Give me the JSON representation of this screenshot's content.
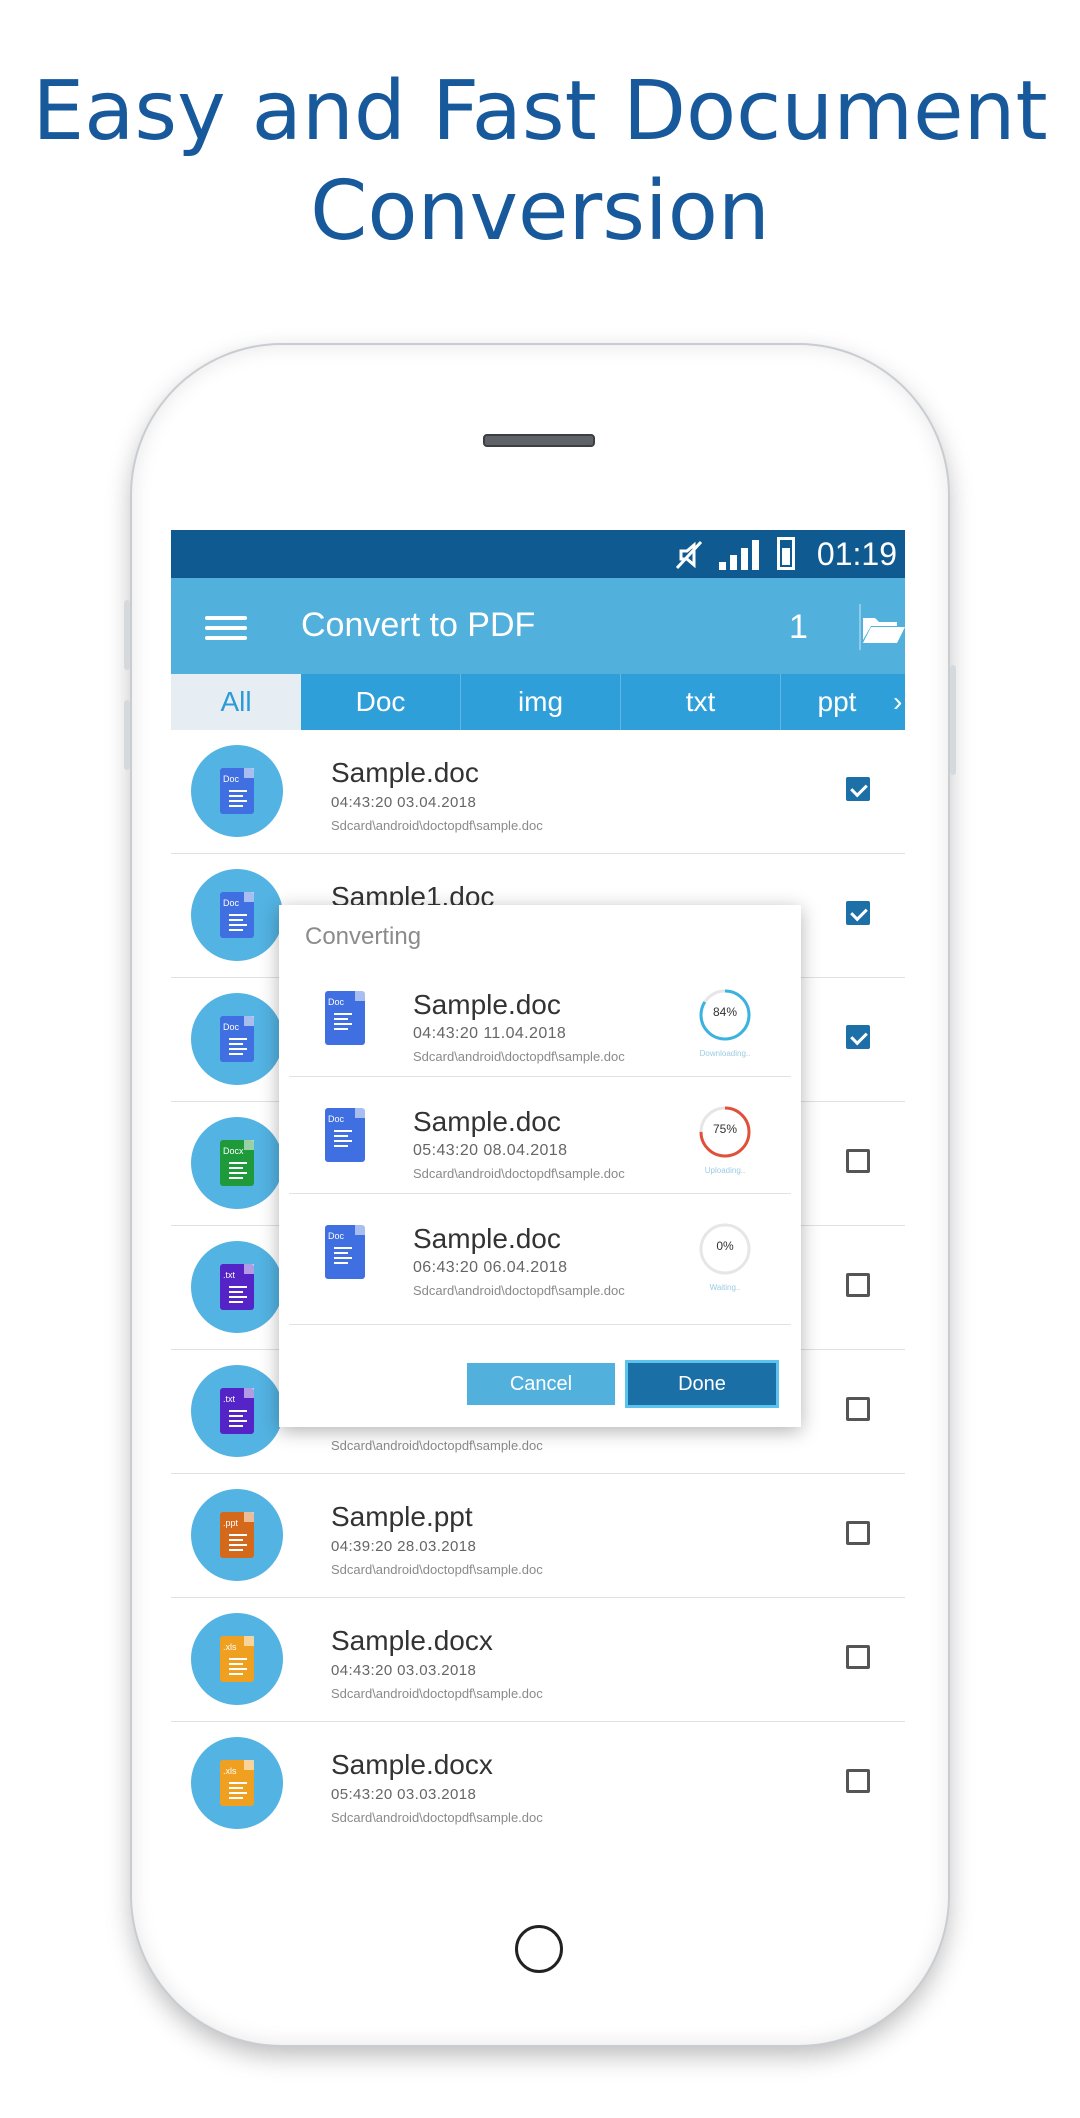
{
  "headline": {
    "line1": "Easy and Fast Document",
    "line2": "Conversion"
  },
  "status_bar": {
    "time": "01:19",
    "icons": [
      "mute-icon",
      "signal-icon",
      "battery-icon"
    ]
  },
  "app_bar": {
    "title": "Convert to PDF",
    "count": "1",
    "menu_icon": "hamburger-menu-icon",
    "folder_icon": "folder-open-icon"
  },
  "tabs": [
    {
      "label": "All",
      "active": true
    },
    {
      "label": "Doc"
    },
    {
      "label": "img"
    },
    {
      "label": "txt"
    },
    {
      "label": "ppt"
    }
  ],
  "tabs_more": "›",
  "files": [
    {
      "name": "Sample.doc",
      "meta": "04:43:20   03.04.2018",
      "path": "Sdcard\\android\\doctopdf\\sample.doc",
      "type": "Doc",
      "color": "#3f6fe0",
      "checked": true
    },
    {
      "name": "Sample1.doc",
      "meta": "",
      "path": "",
      "type": "Doc",
      "color": "#3f6fe0",
      "checked": true
    },
    {
      "name": "",
      "meta": "",
      "path": "",
      "type": "Doc",
      "color": "#3f6fe0",
      "checked": true
    },
    {
      "name": "",
      "meta": "",
      "path": "",
      "type": "Docx",
      "color": "#1e9a3a",
      "checked": false
    },
    {
      "name": "",
      "meta": "",
      "path": "",
      "type": ".txt",
      "color": "#5424c7",
      "checked": false
    },
    {
      "name": "",
      "meta": "",
      "path": "Sdcard\\android\\doctopdf\\sample.doc",
      "type": ".txt",
      "color": "#5424c7",
      "checked": false
    },
    {
      "name": "Sample.ppt",
      "meta": "04:39:20   28.03.2018",
      "path": "Sdcard\\android\\doctopdf\\sample.doc",
      "type": ".ppt",
      "color": "#d4691c",
      "checked": false
    },
    {
      "name": "Sample.docx",
      "meta": "04:43:20   03.03.2018",
      "path": "Sdcard\\android\\doctopdf\\sample.doc",
      "type": ".xls",
      "color": "#f0a020",
      "checked": false
    },
    {
      "name": "Sample.docx",
      "meta": "05:43:20   03.03.2018",
      "path": "Sdcard\\android\\doctopdf\\sample.doc",
      "type": ".xls",
      "color": "#f0a020",
      "checked": false
    }
  ],
  "dialog": {
    "title": "Converting",
    "items": [
      {
        "name": "Sample.doc",
        "meta": "04:43:20   11.04.2018",
        "path": "Sdcard\\android\\doctopdf\\sample.doc",
        "progress": 84,
        "progress_label": "84%",
        "status": "Downloading..",
        "ring_color": "#3bb3e0"
      },
      {
        "name": "Sample.doc",
        "meta": "05:43:20   08.04.2018",
        "path": "Sdcard\\android\\doctopdf\\sample.doc",
        "progress": 75,
        "progress_label": "75%",
        "status": "Uploading..",
        "ring_color": "#e0503a"
      },
      {
        "name": "Sample.doc",
        "meta": "06:43:20   06.04.2018",
        "path": "Sdcard\\android\\doctopdf\\sample.doc",
        "progress": 0,
        "progress_label": "0%",
        "status": "Waiting..",
        "ring_color": "#cccccc"
      }
    ],
    "cancel_label": "Cancel",
    "done_label": "Done"
  }
}
